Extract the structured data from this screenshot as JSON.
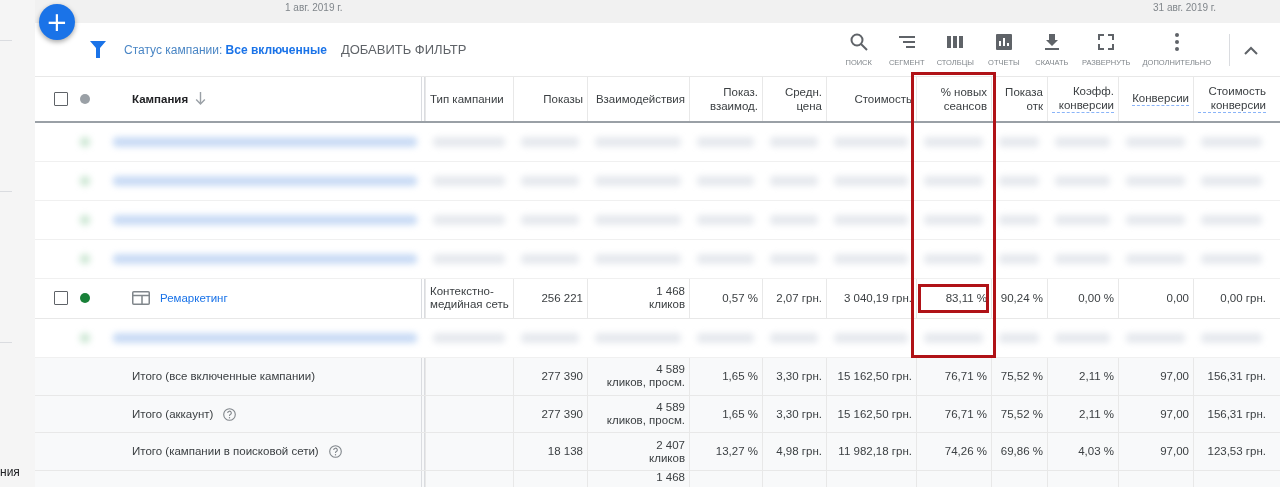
{
  "sidebar": {
    "text": "ния"
  },
  "date_range": {
    "start": "1 авг. 2019 г.",
    "end": "31 авг. 2019 г."
  },
  "add_button": {
    "label": "+"
  },
  "filter": {
    "text": "Статус кампании: **Все включенные**",
    "add_label": "ДОБАВИТЬ ФИЛЬТР"
  },
  "toolbar": [
    {
      "kind": "search",
      "label": "ПОИСК"
    },
    {
      "kind": "segment",
      "label": "СЕГМЕНТ"
    },
    {
      "kind": "columns",
      "label": "СТОЛБЦЫ"
    },
    {
      "kind": "reports",
      "label": "ОТЧЕТЫ"
    },
    {
      "kind": "download",
      "label": "СКАЧАТЬ"
    },
    {
      "kind": "expand",
      "label": "РАЗВЕРНУТЬ"
    },
    {
      "kind": "more",
      "label": "ДОПОЛНИТЕЛЬНО"
    }
  ],
  "table": {
    "header_checked": false,
    "columns": [
      {
        "label": "Кампания",
        "sorted": true,
        "underlined": false
      },
      {
        "label": "Тип кампании",
        "sorted": false,
        "underlined": false
      },
      {
        "label": "Показы",
        "sorted": false,
        "underlined": false
      },
      {
        "label": "Взаимодействия",
        "sorted": false,
        "underlined": false
      },
      {
        "label": "Показ. взаимод.",
        "sorted": false,
        "underlined": false
      },
      {
        "label": "Средн. цена",
        "sorted": false,
        "underlined": false
      },
      {
        "label": "Стоимость",
        "sorted": false,
        "underlined": false
      },
      {
        "label": "% новых сеансов",
        "sorted": false,
        "underlined": false,
        "highlighted": true
      },
      {
        "label": "Показа отк",
        "sorted": false,
        "underlined": false
      },
      {
        "label": "Коэфф. конверсии",
        "sorted": false,
        "underlined": true
      },
      {
        "label": "Конверсии",
        "sorted": false,
        "underlined": true
      },
      {
        "label": "Стоимость конверсии",
        "sorted": false,
        "underlined": true
      }
    ],
    "rows": [
      {
        "kind": "blurred"
      },
      {
        "kind": "blurred"
      },
      {
        "kind": "blurred"
      },
      {
        "kind": "blurred"
      },
      {
        "kind": "campaign",
        "checked": false,
        "color": "#188038",
        "name": "Ремаркетинг",
        "cells": [
          "Контекстно-медийная сеть",
          "256 221",
          "1 468\nкликов",
          "0,57 %",
          "2,07 грн.",
          "3 040,19 грн.",
          "83,11 %",
          "90,24 %",
          "0,00 %",
          "0,00",
          "0,00 грн."
        ],
        "highlighted": true
      },
      {
        "kind": "blurred"
      },
      {
        "kind": "total",
        "name": "Итого (все включенные кампании)",
        "help": false,
        "cells": [
          "",
          "277 390",
          "4 589\nкликов, просм.",
          "1,65 %",
          "3,30 грн.",
          "15 162,50 грн.",
          "76,71 %",
          "75,52 %",
          "2,11 %",
          "97,00",
          "156,31 грн."
        ]
      },
      {
        "kind": "total",
        "name": "Итого (аккаунт)",
        "help": true,
        "cells": [
          "",
          "277 390",
          "4 589\nкликов, просм.",
          "1,65 %",
          "3,30 грн.",
          "15 162,50 грн.",
          "76,71 %",
          "75,52 %",
          "2,11 %",
          "97,00",
          "156,31 грн."
        ]
      },
      {
        "kind": "total",
        "name": "Итого (кампании в поисковой сети)",
        "help": true,
        "cells": [
          "",
          "18 138",
          "2 407\nкликов",
          "13,27 %",
          "4,98 грн.",
          "11 982,18 грн.",
          "74,26 %",
          "69,86 %",
          "4,03 %",
          "97,00",
          "123,53 грн."
        ]
      },
      {
        "kind": "cut",
        "cells": [
          "",
          "",
          "1 468",
          "",
          "",
          "",
          "",
          "",
          "",
          "",
          ""
        ]
      }
    ]
  }
}
